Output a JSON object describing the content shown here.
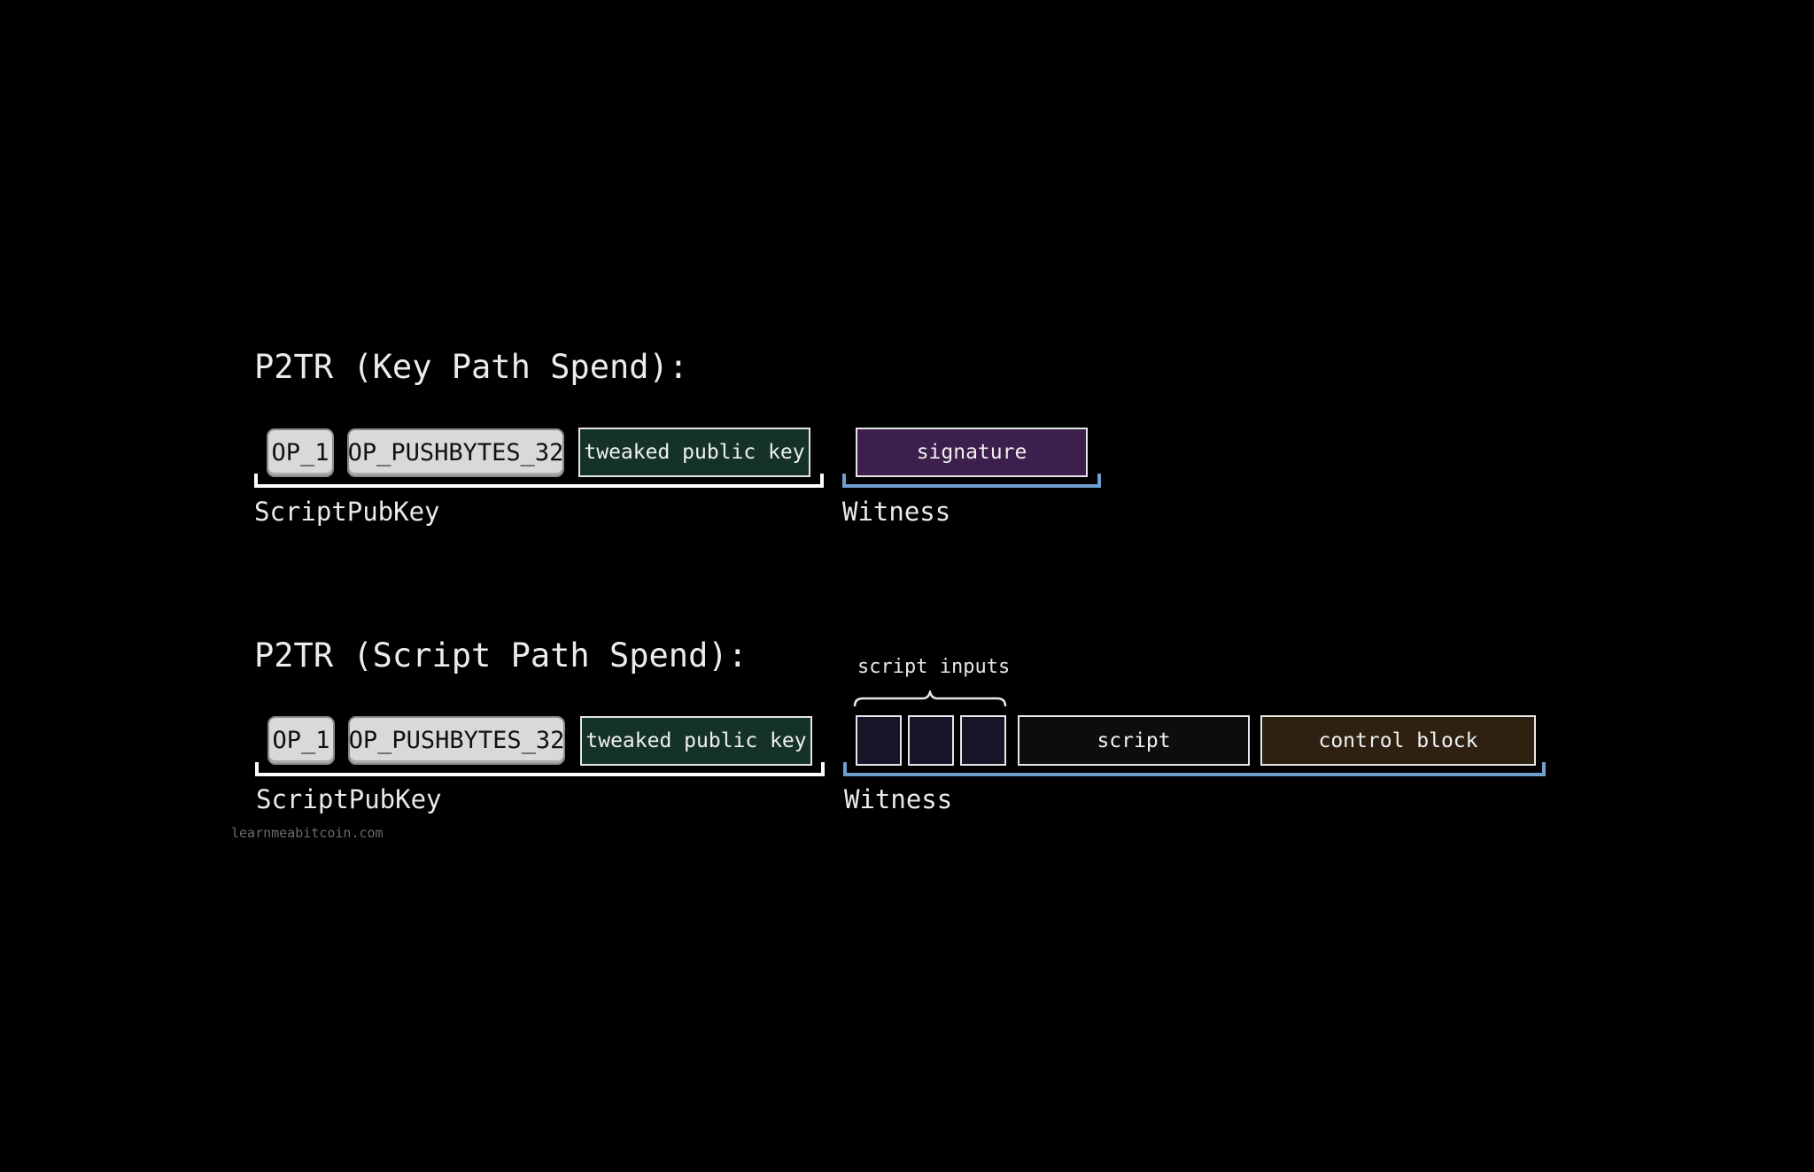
{
  "key_path": {
    "title": "P2TR (Key Path Spend):",
    "ops": [
      "OP_1",
      "OP_PUSHBYTES_32"
    ],
    "pubkey_label": "tweaked public key",
    "witness_field": "signature",
    "scriptpubkey_label": "ScriptPubKey",
    "witness_label": "Witness"
  },
  "script_path": {
    "title": "P2TR (Script Path Spend):",
    "ops": [
      "OP_1",
      "OP_PUSHBYTES_32"
    ],
    "pubkey_label": "tweaked public key",
    "script_inputs_label": "script inputs",
    "script_field": "script",
    "control_block_field": "control block",
    "scriptpubkey_label": "ScriptPubKey",
    "witness_label": "Witness"
  },
  "footer": "learnmeabitcoin.com",
  "colors": {
    "background": "#000000",
    "op_fill": "#d9d9d9",
    "pubkey_fill": "#14322a",
    "signature_fill": "#3c1f4c",
    "script_fill": "#0d0d0d",
    "control_block_fill": "#2e2112",
    "script_input_fill": "#161628",
    "scriptpubkey_bracket": "#ffffff",
    "witness_bracket": "#6e9fd0"
  }
}
